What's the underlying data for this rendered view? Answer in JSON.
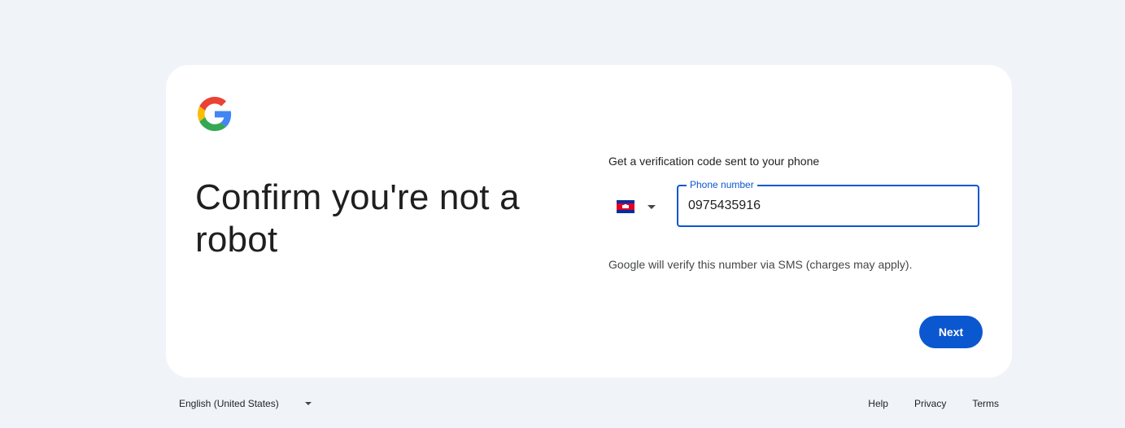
{
  "card": {
    "headline": "Confirm you're not a robot",
    "logo_icon": "google-g-icon"
  },
  "verification": {
    "instruction": "Get a verification code sent to your phone",
    "country_flag_icon": "cambodia-flag-icon",
    "phone_label": "Phone number",
    "phone_value": "0975435916",
    "sms_note": "Google will verify this number via SMS (charges may apply).",
    "next_label": "Next"
  },
  "footer": {
    "language": "English (United States)",
    "links": [
      "Help",
      "Privacy",
      "Terms"
    ]
  },
  "colors": {
    "page_background": "#f0f4f9",
    "card_background": "#ffffff",
    "accent": "#0b57d0"
  }
}
